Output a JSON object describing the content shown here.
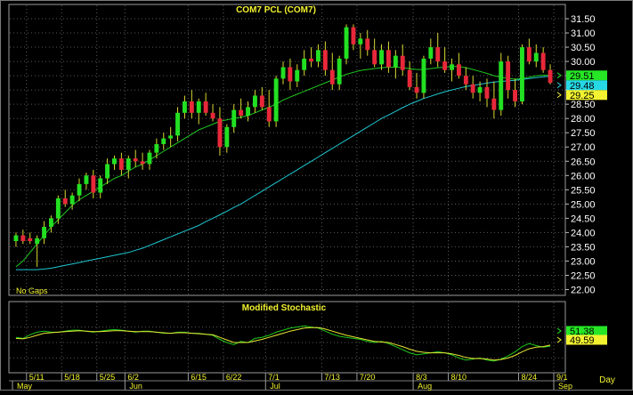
{
  "chart_data": [
    {
      "type": "candlestick",
      "title": "COM7  PCL  (COM7)",
      "note": "No  Gaps",
      "ylim": [
        22.0,
        31.5
      ],
      "yticks": [
        "22.00",
        "22.50",
        "23.00",
        "23.50",
        "24.00",
        "24.50",
        "25.00",
        "25.50",
        "26.00",
        "26.50",
        "27.00",
        "27.50",
        "28.00",
        "28.50",
        "29.00",
        "29.50",
        "30.00",
        "30.50",
        "31.00",
        "31.50"
      ],
      "ytick_values": [
        22.0,
        22.5,
        23.0,
        23.5,
        24.0,
        24.5,
        25.0,
        25.5,
        26.0,
        26.5,
        27.0,
        27.5,
        28.0,
        28.5,
        29.0,
        29.5,
        30.0,
        30.5,
        31.0,
        31.5
      ],
      "last_value_badges": [
        {
          "text": "29.51",
          "color": "#26e626",
          "value": 29.51
        },
        {
          "text": "29.48",
          "color": "#26d8e6",
          "value": 29.48
        },
        {
          "text": "29.25",
          "color": "#f2f230",
          "value": 29.25
        }
      ],
      "colors": {
        "up": "#22e022",
        "down": "#e8283a",
        "wick": "#d8d832",
        "ma_fast": "#1ec81e",
        "ma_slow": "#1ec8d2",
        "grid": "#5a5a5a"
      },
      "candles": [
        [
          23.7,
          24.0,
          23.5,
          23.9
        ],
        [
          23.9,
          24.1,
          23.6,
          23.7
        ],
        [
          23.8,
          24.0,
          23.6,
          23.7
        ],
        [
          23.6,
          23.9,
          22.8,
          23.8
        ],
        [
          23.8,
          24.4,
          23.6,
          24.2
        ],
        [
          24.2,
          24.6,
          24.0,
          24.5
        ],
        [
          24.5,
          25.3,
          24.3,
          25.2
        ],
        [
          25.2,
          25.5,
          24.9,
          25.0
        ],
        [
          25.0,
          25.4,
          24.8,
          25.3
        ],
        [
          25.3,
          25.9,
          25.1,
          25.7
        ],
        [
          25.7,
          26.1,
          25.5,
          26.0
        ],
        [
          26.0,
          26.2,
          25.2,
          25.4
        ],
        [
          25.4,
          26.0,
          25.2,
          25.9
        ],
        [
          25.9,
          26.6,
          25.7,
          26.4
        ],
        [
          26.4,
          26.7,
          26.2,
          26.6
        ],
        [
          26.6,
          26.8,
          26.0,
          26.2
        ],
        [
          26.2,
          26.7,
          25.9,
          26.6
        ],
        [
          26.6,
          26.9,
          26.3,
          26.5
        ],
        [
          26.5,
          26.8,
          26.2,
          26.4
        ],
        [
          26.4,
          26.9,
          26.2,
          26.8
        ],
        [
          26.8,
          27.3,
          26.6,
          27.1
        ],
        [
          27.1,
          27.5,
          26.9,
          27.3
        ],
        [
          27.3,
          27.7,
          27.0,
          27.4
        ],
        [
          27.4,
          28.4,
          27.2,
          28.2
        ],
        [
          28.2,
          28.8,
          28.0,
          28.6
        ],
        [
          28.6,
          29.0,
          28.0,
          28.2
        ],
        [
          28.2,
          28.7,
          27.8,
          28.6
        ],
        [
          28.6,
          28.9,
          28.1,
          28.2
        ],
        [
          28.2,
          28.5,
          27.9,
          28.0
        ],
        [
          28.0,
          28.4,
          26.7,
          27.0
        ],
        [
          27.0,
          27.8,
          26.8,
          27.7
        ],
        [
          27.7,
          28.5,
          27.5,
          28.3
        ],
        [
          28.3,
          28.7,
          28.0,
          28.1
        ],
        [
          28.1,
          28.6,
          27.9,
          28.4
        ],
        [
          28.4,
          29.0,
          28.2,
          28.8
        ],
        [
          28.8,
          29.1,
          28.3,
          28.4
        ],
        [
          28.4,
          29.0,
          27.7,
          27.9
        ],
        [
          27.9,
          29.5,
          27.7,
          29.4
        ],
        [
          29.4,
          30.0,
          29.2,
          29.8
        ],
        [
          29.8,
          30.1,
          29.0,
          29.3
        ],
        [
          29.3,
          29.9,
          29.1,
          29.7
        ],
        [
          29.7,
          30.4,
          29.5,
          30.1
        ],
        [
          30.1,
          30.5,
          29.8,
          30.0
        ],
        [
          30.0,
          30.6,
          29.8,
          30.4
        ],
        [
          30.4,
          30.7,
          29.5,
          29.7
        ],
        [
          29.7,
          30.3,
          29.0,
          29.2
        ],
        [
          29.2,
          30.2,
          29.0,
          30.1
        ],
        [
          30.1,
          31.3,
          29.9,
          31.2
        ],
        [
          31.2,
          31.3,
          30.4,
          30.6
        ],
        [
          30.6,
          31.0,
          30.1,
          30.8
        ],
        [
          30.8,
          31.1,
          30.2,
          30.4
        ],
        [
          30.4,
          30.8,
          29.8,
          29.9
        ],
        [
          29.9,
          30.6,
          29.7,
          30.4
        ],
        [
          30.4,
          30.7,
          29.6,
          29.8
        ],
        [
          29.8,
          30.4,
          29.4,
          30.2
        ],
        [
          30.2,
          30.6,
          29.5,
          29.7
        ],
        [
          29.7,
          30.0,
          29.0,
          29.1
        ],
        [
          29.1,
          29.6,
          28.7,
          28.9
        ],
        [
          28.9,
          30.2,
          28.7,
          30.1
        ],
        [
          30.1,
          30.8,
          29.9,
          30.5
        ],
        [
          30.5,
          31.0,
          29.8,
          30.0
        ],
        [
          30.0,
          30.5,
          29.6,
          29.7
        ],
        [
          29.7,
          30.1,
          29.3,
          29.9
        ],
        [
          29.9,
          30.3,
          29.4,
          29.5
        ],
        [
          29.5,
          29.8,
          29.0,
          29.2
        ],
        [
          29.2,
          29.5,
          28.7,
          28.9
        ],
        [
          28.9,
          29.3,
          28.6,
          29.1
        ],
        [
          29.1,
          29.4,
          28.4,
          28.7
        ],
        [
          28.7,
          29.3,
          28.0,
          28.3
        ],
        [
          28.3,
          30.3,
          28.1,
          30.0
        ],
        [
          30.0,
          30.2,
          28.7,
          29.0
        ],
        [
          29.0,
          29.4,
          28.4,
          28.6
        ],
        [
          28.6,
          30.6,
          28.5,
          30.5
        ],
        [
          30.5,
          30.8,
          29.9,
          30.0
        ],
        [
          30.0,
          30.6,
          29.8,
          30.3
        ],
        [
          30.3,
          30.5,
          29.6,
          29.7
        ],
        [
          29.7,
          29.9,
          29.2,
          29.25
        ]
      ],
      "ma_fast": [
        22.8,
        23.0,
        23.3,
        23.6,
        23.9,
        24.2,
        24.45,
        24.7,
        24.95,
        25.15,
        25.3,
        25.45,
        25.6,
        25.75,
        25.9,
        26.0,
        26.15,
        26.3,
        26.4,
        26.55,
        26.7,
        26.85,
        27.0,
        27.15,
        27.3,
        27.45,
        27.6,
        27.7,
        27.8,
        27.9,
        27.95,
        28.0,
        28.05,
        28.1,
        28.2,
        28.3,
        28.4,
        28.5,
        28.65,
        28.75,
        28.85,
        28.95,
        29.05,
        29.15,
        29.25,
        29.35,
        29.45,
        29.55,
        29.62,
        29.68,
        29.72,
        29.75,
        29.78,
        29.8,
        29.8,
        29.78,
        29.75,
        29.72,
        29.72,
        29.75,
        29.78,
        29.8,
        29.82,
        29.82,
        29.78,
        29.72,
        29.65,
        29.58,
        29.5,
        29.45,
        29.4,
        29.38,
        29.4,
        29.45,
        29.5,
        29.52,
        29.51
      ],
      "ma_slow": [
        22.7,
        22.7,
        22.7,
        22.7,
        22.72,
        22.75,
        22.8,
        22.85,
        22.9,
        22.95,
        23.0,
        23.05,
        23.1,
        23.15,
        23.2,
        23.25,
        23.3,
        23.38,
        23.45,
        23.55,
        23.65,
        23.75,
        23.85,
        23.95,
        24.05,
        24.15,
        24.25,
        24.38,
        24.5,
        24.62,
        24.75,
        24.88,
        25.0,
        25.15,
        25.3,
        25.45,
        25.6,
        25.75,
        25.9,
        26.05,
        26.2,
        26.35,
        26.5,
        26.65,
        26.8,
        26.95,
        27.1,
        27.25,
        27.4,
        27.55,
        27.7,
        27.85,
        28.0,
        28.12,
        28.25,
        28.38,
        28.5,
        28.6,
        28.7,
        28.78,
        28.86,
        28.94,
        29.0,
        29.06,
        29.12,
        29.16,
        29.2,
        29.24,
        29.28,
        29.3,
        29.32,
        29.34,
        29.37,
        29.4,
        29.43,
        29.46,
        29.48
      ],
      "xticks": [
        {
          "label": "5/11",
          "i": 2
        },
        {
          "label": "5/18",
          "i": 7
        },
        {
          "label": "5/25",
          "i": 12
        },
        {
          "label": "6/2",
          "i": 16
        },
        {
          "label": "6/15",
          "i": 25
        },
        {
          "label": "6/22",
          "i": 30
        },
        {
          "label": "7/1",
          "i": 36
        },
        {
          "label": "7/13",
          "i": 44
        },
        {
          "label": "7/20",
          "i": 49
        },
        {
          "label": "8/3",
          "i": 57
        },
        {
          "label": "8/10",
          "i": 62
        },
        {
          "label": "8/24",
          "i": 72
        },
        {
          "label": "9/1",
          "i": 77
        }
      ],
      "months": [
        {
          "label": "May",
          "i": 0
        },
        {
          "label": "Jun",
          "i": 16
        },
        {
          "label": "Jul",
          "i": 36
        },
        {
          "label": "Aug",
          "i": 57
        },
        {
          "label": "Sep",
          "i": 77
        }
      ],
      "xlabel": "Day"
    },
    {
      "type": "line",
      "title": "Modified  Stochastic",
      "ylim": [
        0,
        100
      ],
      "series": [
        {
          "values": [
            60,
            58,
            65,
            70,
            72,
            70,
            70,
            72,
            74,
            74,
            72,
            70,
            72,
            74,
            75,
            74,
            72,
            70,
            72,
            72,
            70,
            68,
            68,
            70,
            70,
            68,
            68,
            66,
            64,
            56,
            50,
            46,
            52,
            50,
            58,
            60,
            64,
            70,
            74,
            78,
            80,
            82,
            80,
            78,
            72,
            66,
            62,
            60,
            58,
            56,
            52,
            50,
            52,
            48,
            42,
            36,
            30,
            26,
            28,
            30,
            32,
            30,
            26,
            20,
            16,
            18,
            20,
            16,
            14,
            18,
            24,
            32,
            42,
            48,
            44,
            41,
            43
          ]
        },
        {
          "values": [
            58,
            57,
            60,
            64,
            68,
            69,
            70,
            71,
            72,
            73,
            72,
            71,
            71,
            72,
            73,
            73,
            72,
            71,
            71,
            71,
            70,
            69,
            68,
            69,
            69,
            68,
            67,
            66,
            65,
            60,
            55,
            50,
            50,
            50,
            53,
            56,
            60,
            64,
            68,
            72,
            75,
            78,
            79,
            79,
            76,
            72,
            68,
            64,
            61,
            58,
            55,
            52,
            51,
            50,
            46,
            42,
            37,
            33,
            31,
            30,
            30,
            30,
            28,
            25,
            21,
            19,
            19,
            18,
            16,
            17,
            20,
            25,
            32,
            38,
            41,
            42,
            45
          ]
        }
      ],
      "last_value_badges": [
        {
          "text": "51.38",
          "color": "#26e626",
          "value": 51.38
        },
        {
          "text": "49.59",
          "color": "#f2f230",
          "value": 49.59
        }
      ],
      "colors": {
        "k": "#1ec81e",
        "d": "#e6e632"
      }
    }
  ]
}
